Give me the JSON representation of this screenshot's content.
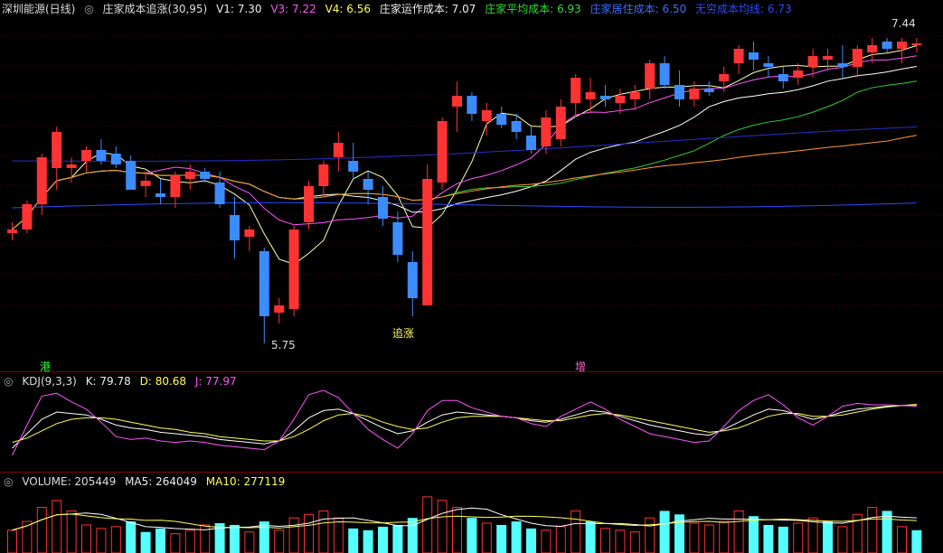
{
  "header": {
    "stock_name": "深圳能源(日线)",
    "indicator": "庄家成本追涨(30,95)",
    "v1": "V1: 7.30",
    "v3": "V3: 7.22",
    "v4": "V4: 6.56",
    "operating_cost": "庄家运作成本: 7.07",
    "avg_cost": "庄家平均成本: 6.93",
    "resident_cost": "庄家居住成本: 6.50",
    "infinite_cost": "无穷成本均线: 6.73"
  },
  "annotations": {
    "high": "7.44",
    "low": "5.75",
    "chase": "追涨",
    "signal1": "港",
    "signal2": "增"
  },
  "kdj": {
    "title": "KDJ(9,3,3)",
    "k": "K: 79.78",
    "d": "D: 80.68",
    "j": "J: 77.97"
  },
  "volume": {
    "title": "VOLUME: 205449",
    "ma5": "MA5: 264049",
    "ma10": "MA10: 277119"
  },
  "colors": {
    "up": "#ff3333",
    "down": "#3b8cff",
    "panel_border": "#8a0000",
    "volume_down": "#55ffff"
  },
  "candles": [
    [
      6.36,
      6.42,
      6.32,
      6.38
    ],
    [
      6.38,
      6.54,
      6.36,
      6.52
    ],
    [
      6.52,
      6.8,
      6.46,
      6.78
    ],
    [
      6.72,
      6.95,
      6.6,
      6.92
    ],
    [
      6.72,
      6.78,
      6.64,
      6.74
    ],
    [
      6.76,
      6.84,
      6.7,
      6.82
    ],
    [
      6.82,
      6.88,
      6.74,
      6.76
    ],
    [
      6.8,
      6.84,
      6.72,
      6.74
    ],
    [
      6.76,
      6.79,
      6.6,
      6.6
    ],
    [
      6.62,
      6.7,
      6.56,
      6.65
    ],
    [
      6.58,
      6.66,
      6.52,
      6.56
    ],
    [
      6.56,
      6.7,
      6.5,
      6.68
    ],
    [
      6.66,
      6.74,
      6.6,
      6.7
    ],
    [
      6.7,
      6.72,
      6.64,
      6.66
    ],
    [
      6.64,
      6.7,
      6.5,
      6.52
    ],
    [
      6.46,
      6.56,
      6.22,
      6.32
    ],
    [
      6.34,
      6.4,
      6.26,
      6.38
    ],
    [
      6.26,
      6.28,
      5.75,
      5.9
    ],
    [
      5.92,
      6.0,
      5.86,
      5.96
    ],
    [
      5.94,
      6.4,
      5.9,
      6.38
    ],
    [
      6.42,
      6.65,
      6.38,
      6.62
    ],
    [
      6.62,
      6.76,
      6.56,
      6.74
    ],
    [
      6.78,
      6.92,
      6.7,
      6.86
    ],
    [
      6.76,
      6.86,
      6.66,
      6.7
    ],
    [
      6.66,
      6.7,
      6.52,
      6.6
    ],
    [
      6.56,
      6.62,
      6.4,
      6.44
    ],
    [
      6.42,
      6.48,
      6.2,
      6.24
    ],
    [
      6.2,
      6.26,
      5.9,
      6.0
    ],
    [
      5.96,
      6.74,
      5.96,
      6.66
    ],
    [
      6.64,
      7.0,
      6.6,
      6.98
    ],
    [
      7.06,
      7.2,
      6.92,
      7.12
    ],
    [
      7.12,
      7.14,
      6.98,
      7.02
    ],
    [
      6.98,
      7.08,
      6.9,
      7.04
    ],
    [
      7.02,
      7.06,
      6.94,
      6.96
    ],
    [
      6.98,
      7.02,
      6.88,
      6.92
    ],
    [
      6.9,
      6.96,
      6.8,
      6.82
    ],
    [
      6.84,
      7.04,
      6.8,
      7.0
    ],
    [
      6.88,
      7.1,
      6.84,
      7.06
    ],
    [
      7.08,
      7.24,
      7.0,
      7.22
    ],
    [
      7.1,
      7.22,
      7.02,
      7.14
    ],
    [
      7.12,
      7.18,
      7.06,
      7.1
    ],
    [
      7.08,
      7.16,
      7.02,
      7.12
    ],
    [
      7.1,
      7.18,
      7.04,
      7.14
    ],
    [
      7.16,
      7.32,
      7.1,
      7.3
    ],
    [
      7.3,
      7.34,
      7.16,
      7.18
    ],
    [
      7.18,
      7.26,
      7.06,
      7.1
    ],
    [
      7.1,
      7.2,
      7.06,
      7.16
    ],
    [
      7.16,
      7.2,
      7.12,
      7.14
    ],
    [
      7.2,
      7.28,
      7.14,
      7.24
    ],
    [
      7.3,
      7.4,
      7.24,
      7.38
    ],
    [
      7.36,
      7.42,
      7.26,
      7.32
    ],
    [
      7.3,
      7.34,
      7.22,
      7.28
    ],
    [
      7.24,
      7.28,
      7.16,
      7.2
    ],
    [
      7.22,
      7.3,
      7.18,
      7.26
    ],
    [
      7.28,
      7.38,
      7.22,
      7.34
    ],
    [
      7.32,
      7.38,
      7.26,
      7.34
    ],
    [
      7.3,
      7.4,
      7.22,
      7.28
    ],
    [
      7.28,
      7.4,
      7.22,
      7.38
    ],
    [
      7.36,
      7.44,
      7.3,
      7.4
    ],
    [
      7.42,
      7.44,
      7.36,
      7.38
    ],
    [
      7.38,
      7.44,
      7.3,
      7.42
    ],
    [
      7.4,
      7.44,
      7.36,
      7.41
    ]
  ],
  "kdj_series": {
    "k": [
      20,
      40,
      60,
      70,
      68,
      66,
      60,
      52,
      48,
      46,
      42,
      40,
      38,
      36,
      32,
      30,
      28,
      26,
      30,
      44,
      62,
      72,
      74,
      68,
      58,
      48,
      40,
      44,
      56,
      66,
      70,
      68,
      66,
      64,
      62,
      58,
      56,
      60,
      66,
      72,
      70,
      64,
      58,
      52,
      48,
      44,
      40,
      38,
      46,
      56,
      66,
      74,
      72,
      66,
      60,
      64,
      70,
      74,
      76,
      78,
      79,
      79.78
    ],
    "d": [
      28,
      34,
      44,
      54,
      60,
      62,
      62,
      60,
      56,
      52,
      48,
      46,
      42,
      40,
      36,
      34,
      32,
      30,
      30,
      36,
      46,
      58,
      66,
      68,
      64,
      56,
      50,
      46,
      48,
      56,
      62,
      64,
      64,
      64,
      62,
      60,
      58,
      58,
      62,
      66,
      68,
      66,
      62,
      58,
      54,
      50,
      46,
      42,
      44,
      48,
      56,
      64,
      68,
      68,
      64,
      64,
      66,
      70,
      74,
      77,
      79,
      80.68
    ],
    "j": [
      10,
      52,
      92,
      96,
      84,
      74,
      56,
      36,
      32,
      34,
      30,
      28,
      30,
      28,
      24,
      22,
      20,
      18,
      30,
      60,
      94,
      100,
      90,
      68,
      46,
      32,
      20,
      40,
      72,
      86,
      86,
      76,
      70,
      64,
      62,
      54,
      50,
      64,
      74,
      84,
      74,
      60,
      50,
      40,
      36,
      32,
      28,
      30,
      50,
      72,
      86,
      94,
      80,
      62,
      52,
      64,
      78,
      82,
      80,
      80,
      79,
      77.97
    ]
  },
  "volumes": [
    [
      130,
      1
    ],
    [
      180,
      1
    ],
    [
      260,
      1
    ],
    [
      300,
      1
    ],
    [
      240,
      1
    ],
    [
      160,
      1
    ],
    [
      140,
      1
    ],
    [
      150,
      1
    ],
    [
      180,
      0
    ],
    [
      120,
      0
    ],
    [
      140,
      0
    ],
    [
      110,
      1
    ],
    [
      130,
      1
    ],
    [
      160,
      1
    ],
    [
      170,
      0
    ],
    [
      160,
      0
    ],
    [
      120,
      1
    ],
    [
      180,
      0
    ],
    [
      130,
      1
    ],
    [
      200,
      1
    ],
    [
      220,
      1
    ],
    [
      240,
      1
    ],
    [
      200,
      1
    ],
    [
      140,
      0
    ],
    [
      130,
      0
    ],
    [
      150,
      0
    ],
    [
      160,
      0
    ],
    [
      200,
      0
    ],
    [
      320,
      1
    ],
    [
      300,
      1
    ],
    [
      260,
      1
    ],
    [
      200,
      0
    ],
    [
      170,
      1
    ],
    [
      160,
      0
    ],
    [
      180,
      0
    ],
    [
      140,
      0
    ],
    [
      130,
      1
    ],
    [
      150,
      1
    ],
    [
      240,
      1
    ],
    [
      180,
      0
    ],
    [
      140,
      1
    ],
    [
      130,
      1
    ],
    [
      120,
      1
    ],
    [
      200,
      1
    ],
    [
      240,
      0
    ],
    [
      220,
      0
    ],
    [
      170,
      1
    ],
    [
      160,
      1
    ],
    [
      180,
      1
    ],
    [
      240,
      1
    ],
    [
      210,
      0
    ],
    [
      160,
      0
    ],
    [
      150,
      0
    ],
    [
      170,
      1
    ],
    [
      200,
      1
    ],
    [
      180,
      0
    ],
    [
      150,
      1
    ],
    [
      220,
      1
    ],
    [
      260,
      1
    ],
    [
      240,
      0
    ],
    [
      150,
      1
    ],
    [
      130,
      0
    ]
  ]
}
